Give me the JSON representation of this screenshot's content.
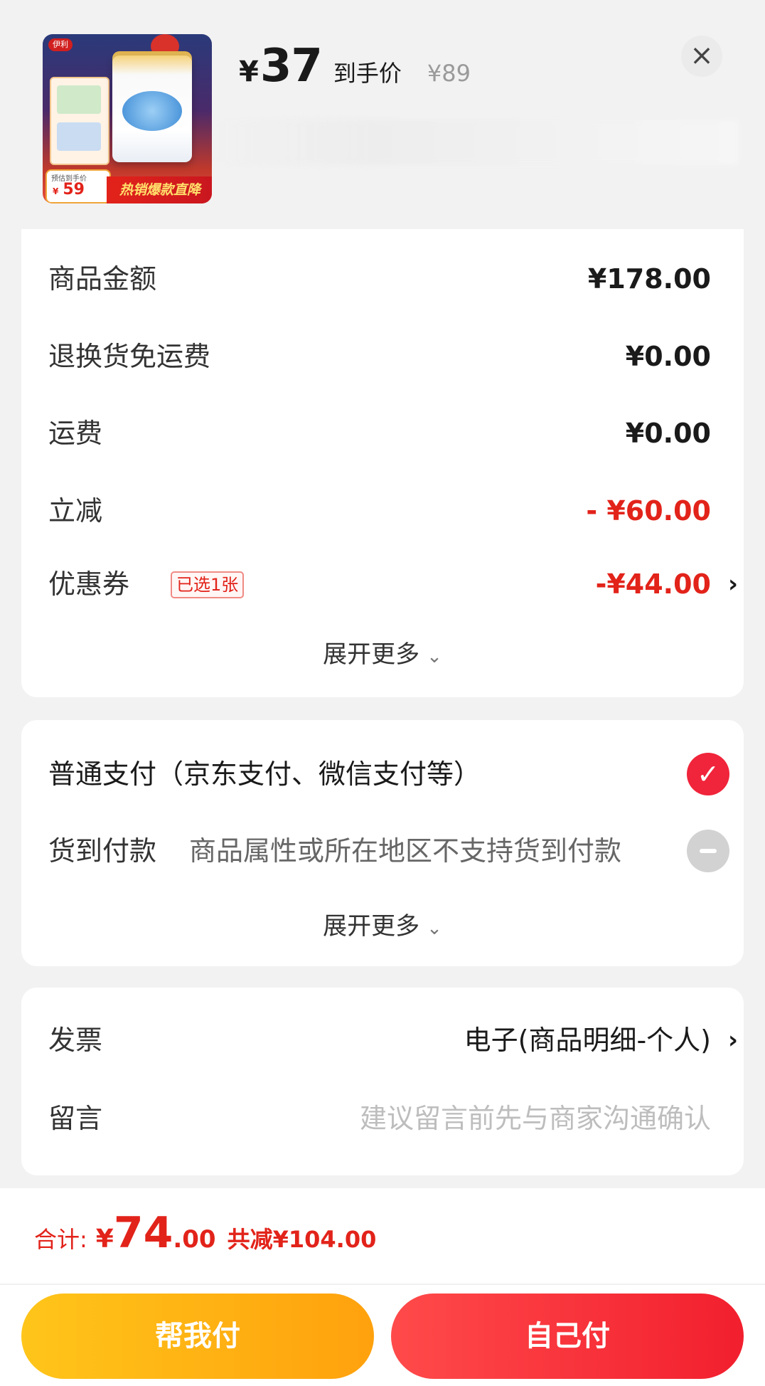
{
  "product": {
    "image_logo": "伊利",
    "image_est_label": "预估到手价",
    "image_est_price": "59",
    "image_est_yen": "¥",
    "image_banner": "热销爆款直降",
    "price_yen": "¥",
    "price": "37",
    "price_label": "到手价",
    "original_price": "¥89"
  },
  "summary": {
    "rows": [
      {
        "label": "商品金额",
        "value": "¥178.00"
      },
      {
        "label": "退换货免运费",
        "value": "¥0.00"
      },
      {
        "label": "运费",
        "value": "¥0.00"
      },
      {
        "label": "立减",
        "value": "- ¥60.00"
      }
    ],
    "coupon": {
      "label": "优惠券",
      "badge": "已选1张",
      "value": "-¥44.00"
    },
    "expand_label": "展开更多"
  },
  "payment": {
    "normal_label": "普通支付（京东支付、微信支付等）",
    "cod_label": "货到付款",
    "cod_note": "商品属性或所在地区不支持货到付款",
    "expand_label": "展开更多"
  },
  "extras": {
    "invoice_label": "发票",
    "invoice_value": "电子(商品明细-个人)",
    "message_label": "留言",
    "message_placeholder": "建议留言前先与商家沟通确认"
  },
  "footer": {
    "total_label": "合计:",
    "total_yen": "¥",
    "total_int": "74",
    "total_dec": ".00",
    "saved": "共减¥104.00",
    "help_pay": "帮我付",
    "self_pay": "自己付"
  },
  "icons": {
    "close": "close-icon",
    "chevron_right": "chevron-right-icon",
    "chevron_down": "chevron-down-icon",
    "check": "check-icon",
    "disabled": "minus-icon"
  },
  "colors": {
    "accent_red": "#e2231a",
    "help_button": "#ffb312",
    "self_button": "#f5283a"
  }
}
